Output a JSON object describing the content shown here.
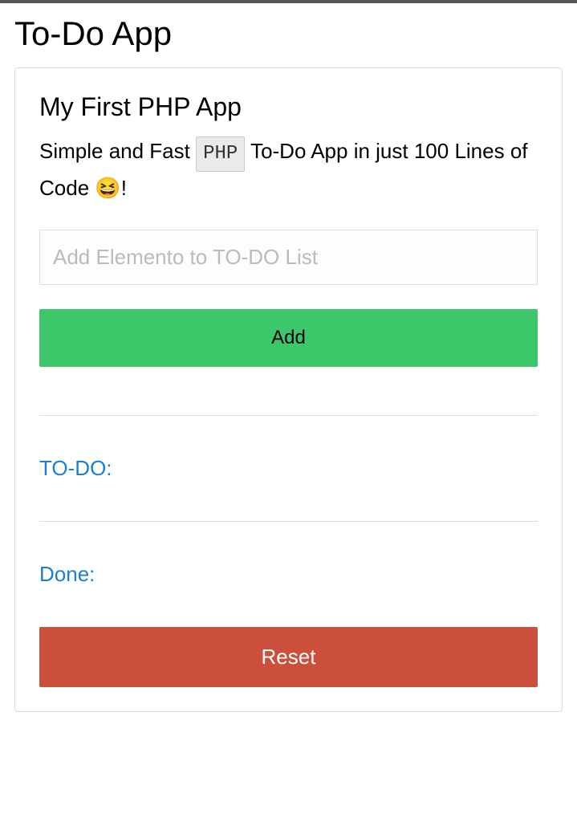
{
  "page": {
    "title": "To-Do App"
  },
  "panel": {
    "subtitle": "My First PHP App",
    "description_prefix": "Simple and Fast ",
    "badge": "PHP",
    "description_suffix": " To-Do App in just 100 Lines of Code 😆!"
  },
  "form": {
    "input_placeholder": "Add Elemento to TO-DO List",
    "input_value": "",
    "add_button_label": "Add"
  },
  "sections": {
    "todo_label": "TO-DO:",
    "done_label": "Done:"
  },
  "reset": {
    "button_label": "Reset"
  }
}
